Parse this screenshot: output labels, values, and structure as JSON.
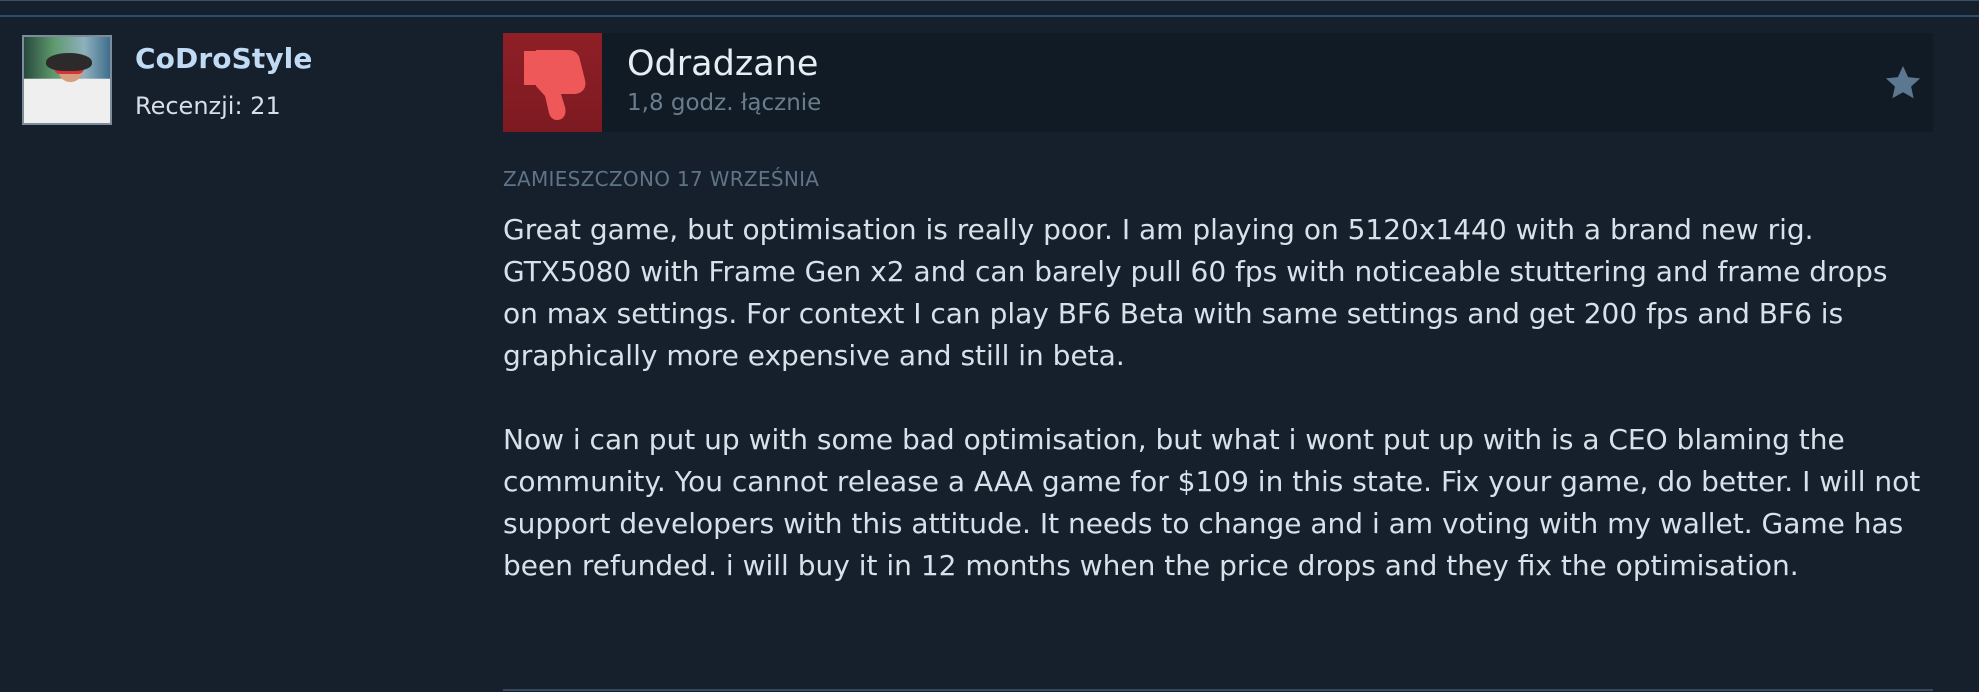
{
  "user": {
    "name": "CoDroStyle",
    "reviews": "Recenzji: 21"
  },
  "review": {
    "verdict": "Odradzane",
    "hours": "1,8 godz. łącznie",
    "posted": "ZAMIESZCZONO 17 WRZEŚNIA",
    "paragraph_1": "Great game, but optimisation is really poor. I am playing on 5120x1440 with a brand new rig. GTX5080 with Frame Gen x2 and can barely pull 60 fps with noticeable stuttering and frame drops on max settings. For context I can play BF6 Beta with same settings and get 200 fps and BF6 is graphically more expensive and still in beta.",
    "paragraph_2": "Now i can put up with some bad optimisation, but what i wont put up with is a CEO blaming the community. You cannot release a AAA game for $109 in this state. Fix your game, do better. I will not support developers with this attitude. It needs to change and i am voting with my wallet. Game has been refunded. i will buy it in 12 months when the price drops and they fix the optimisation."
  },
  "icons": {
    "verdict_icon": "thumbs-down-icon",
    "action_icon": "star-icon"
  },
  "colors": {
    "background": "#1b2838",
    "verdict_red": "#8f1f27",
    "accent_text": "#c1dbf4"
  }
}
